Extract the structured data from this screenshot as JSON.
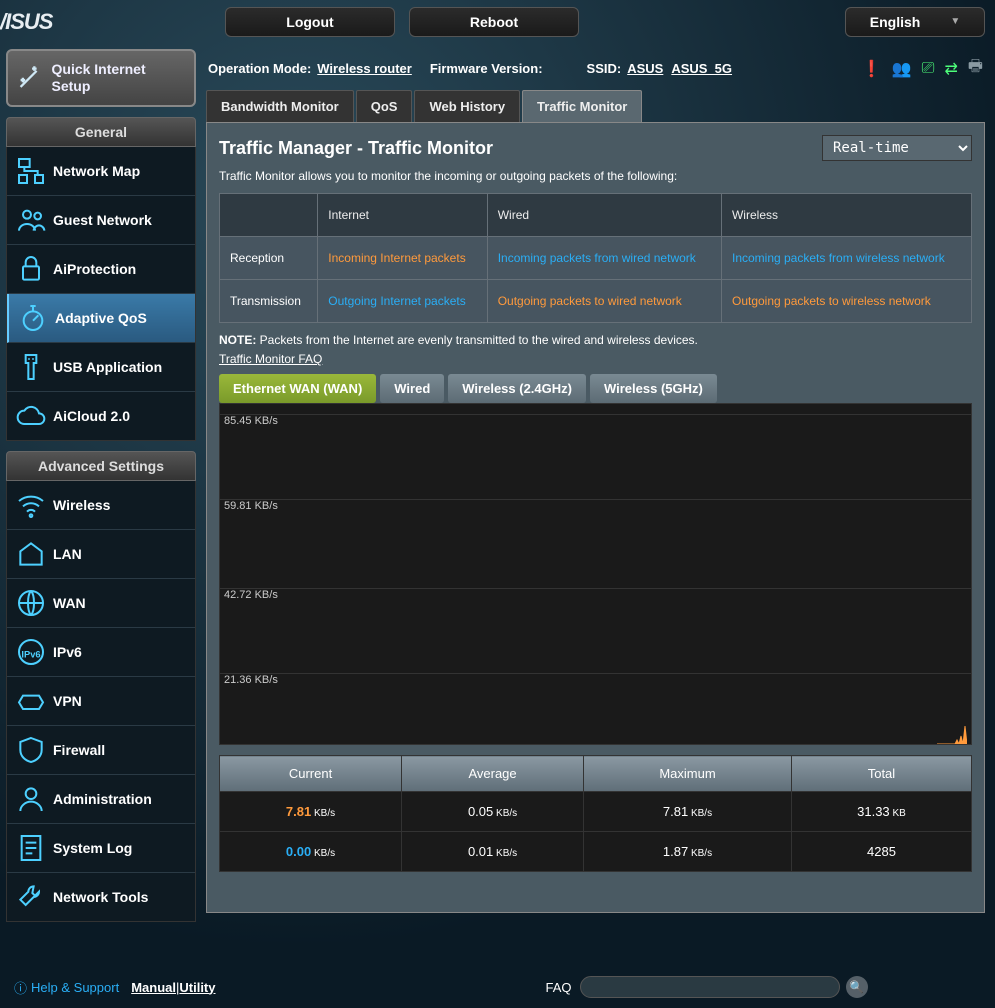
{
  "top": {
    "logout": "Logout",
    "reboot": "Reboot",
    "language": "English"
  },
  "info": {
    "op_mode_label": "Operation Mode:",
    "op_mode": "Wireless router",
    "fw_label": "Firmware Version:",
    "ssid_label": "SSID:",
    "ssid1": "ASUS",
    "ssid2": "ASUS_5G"
  },
  "quick_setup": "Quick Internet Setup",
  "sidebar": {
    "general_header": "General",
    "general": [
      {
        "label": "Network Map"
      },
      {
        "label": "Guest Network"
      },
      {
        "label": "AiProtection"
      },
      {
        "label": "Adaptive QoS"
      },
      {
        "label": "USB Application"
      },
      {
        "label": "AiCloud 2.0"
      }
    ],
    "advanced_header": "Advanced Settings",
    "advanced": [
      {
        "label": "Wireless"
      },
      {
        "label": "LAN"
      },
      {
        "label": "WAN"
      },
      {
        "label": "IPv6"
      },
      {
        "label": "VPN"
      },
      {
        "label": "Firewall"
      },
      {
        "label": "Administration"
      },
      {
        "label": "System Log"
      },
      {
        "label": "Network Tools"
      }
    ]
  },
  "tabs": [
    "Bandwidth Monitor",
    "QoS",
    "Web History",
    "Traffic Monitor"
  ],
  "page_title": "Traffic Manager - Traffic Monitor",
  "time_select": "Real-time",
  "intro": "Traffic Monitor allows you to monitor the incoming or outgoing packets of the following:",
  "packet_table": {
    "headers": [
      "",
      "Internet",
      "Wired",
      "Wireless"
    ],
    "rows": [
      {
        "label": "Reception",
        "cells": [
          {
            "text": "Incoming Internet packets",
            "color": "orange"
          },
          {
            "text": "Incoming packets from wired network",
            "color": "blue"
          },
          {
            "text": "Incoming packets from wireless network",
            "color": "blue"
          }
        ]
      },
      {
        "label": "Transmission",
        "cells": [
          {
            "text": "Outgoing Internet packets",
            "color": "blue"
          },
          {
            "text": "Outgoing packets to wired network",
            "color": "orange"
          },
          {
            "text": "Outgoing packets to wireless network",
            "color": "orange"
          }
        ]
      }
    ]
  },
  "note_label": "NOTE:",
  "note_text": " Packets from the Internet are evenly transmitted to the wired and wireless devices.",
  "faq_link": "Traffic Monitor FAQ",
  "graph_tabs": [
    "Ethernet WAN (WAN)",
    "Wired",
    "Wireless (2.4GHz)",
    "Wireless (5GHz)"
  ],
  "graph_y": [
    "85.45 KB/s",
    "59.81 KB/s",
    "42.72 KB/s",
    "21.36 KB/s"
  ],
  "stats_headers": [
    "Current",
    "Average",
    "Maximum",
    "Total"
  ],
  "stats": [
    {
      "color": "orange",
      "current": "7.81",
      "current_unit": "KB/s",
      "avg": "0.05",
      "avg_unit": "KB/s",
      "max": "7.81",
      "max_unit": "KB/s",
      "total": "31.33",
      "total_unit": "KB"
    },
    {
      "color": "blue",
      "current": "0.00",
      "current_unit": "KB/s",
      "avg": "0.01",
      "avg_unit": "KB/s",
      "max": "1.87",
      "max_unit": "KB/s",
      "total": "4285",
      "total_unit": ""
    }
  ],
  "footer": {
    "help": "Help & Support",
    "manual": "Manual",
    "utility": "Utility",
    "faq": "FAQ"
  },
  "chart_data": {
    "type": "line",
    "title": "Ethernet WAN (WAN) traffic",
    "ylabel": "KB/s",
    "ylim": [
      0,
      85.45
    ],
    "yticks": [
      21.36,
      42.72,
      59.81,
      85.45
    ],
    "series": [
      {
        "name": "Incoming",
        "color": "#ff9a3c",
        "current": 7.81,
        "average": 0.05,
        "maximum": 7.81,
        "total_kb": 31.33
      },
      {
        "name": "Outgoing",
        "color": "#2aaef5",
        "current": 0.0,
        "average": 0.01,
        "maximum": 1.87,
        "total_bytes": 4285
      }
    ]
  }
}
